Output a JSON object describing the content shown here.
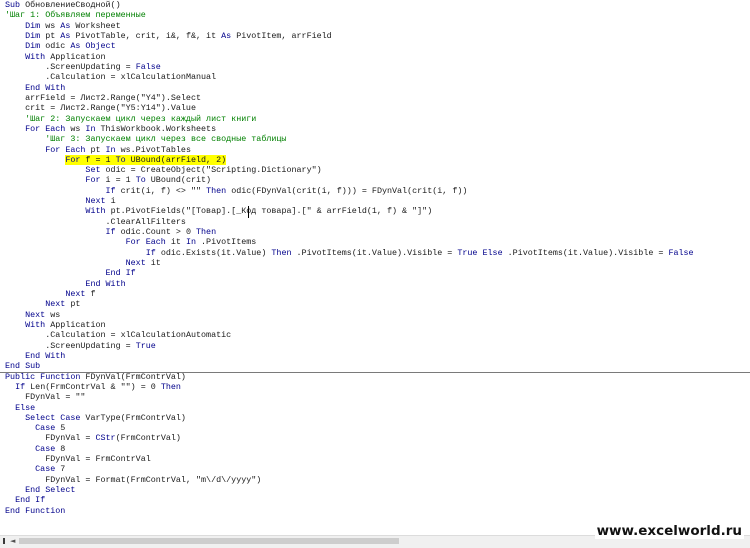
{
  "lines": [
    [
      {
        "t": "Sub ",
        "c": "k"
      },
      {
        "t": "ОбновлениеСводной()",
        "c": "t"
      }
    ],
    [
      {
        "t": "'Шаг 1: Объявляем переменные",
        "c": "c"
      }
    ],
    [
      {
        "t": "    "
      },
      {
        "t": "Dim ",
        "c": "k"
      },
      {
        "t": "ws ",
        "c": "t"
      },
      {
        "t": "As ",
        "c": "k"
      },
      {
        "t": "Worksheet",
        "c": "t"
      }
    ],
    [
      {
        "t": "    "
      },
      {
        "t": "Dim ",
        "c": "k"
      },
      {
        "t": "pt ",
        "c": "t"
      },
      {
        "t": "As ",
        "c": "k"
      },
      {
        "t": "PivotTable, crit, i&, f&, it ",
        "c": "t"
      },
      {
        "t": "As ",
        "c": "k"
      },
      {
        "t": "PivotItem, arrField",
        "c": "t"
      }
    ],
    [
      {
        "t": "    "
      },
      {
        "t": "Dim ",
        "c": "k"
      },
      {
        "t": "odic ",
        "c": "t"
      },
      {
        "t": "As Object",
        "c": "k"
      }
    ],
    [
      {
        "t": "    "
      },
      {
        "t": "With ",
        "c": "k"
      },
      {
        "t": "Application",
        "c": "t"
      }
    ],
    [
      {
        "t": "        "
      },
      {
        "t": ".ScreenUpdating = ",
        "c": "t"
      },
      {
        "t": "False",
        "c": "k"
      }
    ],
    [
      {
        "t": "        "
      },
      {
        "t": ".Calculation = xlCalculationManual",
        "c": "t"
      }
    ],
    [
      {
        "t": "    "
      },
      {
        "t": "End With",
        "c": "k"
      }
    ],
    [
      {
        "t": "    "
      },
      {
        "t": "arrField = Лист2.Range(\"Y4\").Select",
        "c": "t"
      }
    ],
    [
      {
        "t": "    "
      },
      {
        "t": "crit = Лист2.Range(\"Y5:Y14\").Value",
        "c": "t"
      }
    ],
    [
      {
        "t": "    "
      },
      {
        "t": "'Шаг 2: Запускаем цикл через каждый лист книги",
        "c": "c"
      }
    ],
    [
      {
        "t": "    "
      },
      {
        "t": "For Each ",
        "c": "k"
      },
      {
        "t": "ws ",
        "c": "t"
      },
      {
        "t": "In ",
        "c": "k"
      },
      {
        "t": "ThisWorkbook.Worksheets",
        "c": "t"
      }
    ],
    [
      {
        "t": "        "
      },
      {
        "t": "'Шаг 3: Запускаем цикл через все сводные таблицы",
        "c": "c"
      }
    ],
    [
      {
        "t": "        "
      },
      {
        "t": "For Each ",
        "c": "k"
      },
      {
        "t": "pt ",
        "c": "t"
      },
      {
        "t": "In ",
        "c": "k"
      },
      {
        "t": "ws.PivotTables",
        "c": "t"
      }
    ],
    [
      {
        "t": "            "
      },
      {
        "t": "For ",
        "c": "k",
        "h": 1
      },
      {
        "t": "f = 1 ",
        "c": "t",
        "h": 1
      },
      {
        "t": "To ",
        "c": "k",
        "h": 1
      },
      {
        "t": "UBound(arrField, 2)",
        "c": "t",
        "h": 1
      }
    ],
    [
      {
        "t": "                "
      },
      {
        "t": "Set ",
        "c": "k"
      },
      {
        "t": "odic = CreateObject(\"Scripting.Dictionary\")",
        "c": "t"
      }
    ],
    [
      {
        "t": "                "
      },
      {
        "t": "For ",
        "c": "k"
      },
      {
        "t": "i = 1 ",
        "c": "t"
      },
      {
        "t": "To ",
        "c": "k"
      },
      {
        "t": "UBound(crit)",
        "c": "t"
      }
    ],
    [
      {
        "t": "                    "
      },
      {
        "t": "If ",
        "c": "k"
      },
      {
        "t": "crit(i, f) <> \"\" ",
        "c": "t"
      },
      {
        "t": "Then ",
        "c": "k"
      },
      {
        "t": "odic(FDynVal(crit(i, f))) = FDynVal(crit(i, f))",
        "c": "t"
      }
    ],
    [
      {
        "t": "                "
      },
      {
        "t": "Next ",
        "c": "k"
      },
      {
        "t": "i",
        "c": "t"
      }
    ],
    [
      {
        "t": "                "
      },
      {
        "t": "With ",
        "c": "k"
      },
      {
        "t": "pt.PivotFields(\"[Товар].[_Код товара].[\" & arrField(1, f) & \"]\")",
        "c": "t"
      }
    ],
    [
      {
        "t": "                    "
      },
      {
        "t": ".ClearAllFilters",
        "c": "t"
      }
    ],
    [
      {
        "t": "                    "
      },
      {
        "t": "If ",
        "c": "k"
      },
      {
        "t": "odic.Count > 0 ",
        "c": "t"
      },
      {
        "t": "Then",
        "c": "k"
      }
    ],
    [
      {
        "t": "                        "
      },
      {
        "t": "For Each ",
        "c": "k"
      },
      {
        "t": "it ",
        "c": "t"
      },
      {
        "t": "In ",
        "c": "k"
      },
      {
        "t": ".PivotItems",
        "c": "t"
      }
    ],
    [
      {
        "t": "                            "
      },
      {
        "t": "If ",
        "c": "k"
      },
      {
        "t": "odic.Exists(it.Value) ",
        "c": "t"
      },
      {
        "t": "Then ",
        "c": "k"
      },
      {
        "t": ".PivotItems(it.Value).Visible = ",
        "c": "t"
      },
      {
        "t": "True Else ",
        "c": "k"
      },
      {
        "t": ".PivotItems(it.Value).Visible = ",
        "c": "t"
      },
      {
        "t": "False",
        "c": "k"
      }
    ],
    [
      {
        "t": "                        "
      },
      {
        "t": "Next ",
        "c": "k"
      },
      {
        "t": "it",
        "c": "t"
      }
    ],
    [
      {
        "t": "                    "
      },
      {
        "t": "End If",
        "c": "k"
      }
    ],
    [
      {
        "t": "                "
      },
      {
        "t": "End With",
        "c": "k"
      }
    ],
    [
      {
        "t": "            "
      },
      {
        "t": "Next ",
        "c": "k"
      },
      {
        "t": "f",
        "c": "t"
      }
    ],
    [
      {
        "t": "        "
      },
      {
        "t": "Next ",
        "c": "k"
      },
      {
        "t": "pt",
        "c": "t"
      }
    ],
    [
      {
        "t": "    "
      },
      {
        "t": "Next ",
        "c": "k"
      },
      {
        "t": "ws",
        "c": "t"
      }
    ],
    [
      {
        "t": "    "
      },
      {
        "t": "With ",
        "c": "k"
      },
      {
        "t": "Application",
        "c": "t"
      }
    ],
    [
      {
        "t": "        "
      },
      {
        "t": ".Calculation = xlCalculationAutomatic",
        "c": "t"
      }
    ],
    [
      {
        "t": "        "
      },
      {
        "t": ".ScreenUpdating = ",
        "c": "t"
      },
      {
        "t": "True",
        "c": "k"
      }
    ],
    [
      {
        "t": "    "
      },
      {
        "t": "End With",
        "c": "k"
      }
    ],
    [
      {
        "t": "End Sub",
        "c": "k"
      }
    ],
    [
      {
        "t": "Public Function ",
        "c": "k"
      },
      {
        "t": "FDynVal(FrmContrVal)",
        "c": "t"
      }
    ],
    [
      {
        "t": "  "
      },
      {
        "t": "If ",
        "c": "k"
      },
      {
        "t": "Len(FrmContrVal & \"\") = 0 ",
        "c": "t"
      },
      {
        "t": "Then",
        "c": "k"
      }
    ],
    [
      {
        "t": "    "
      },
      {
        "t": "FDynVal = \"\"",
        "c": "t"
      }
    ],
    [
      {
        "t": "  "
      },
      {
        "t": "Else",
        "c": "k"
      }
    ],
    [
      {
        "t": "    "
      },
      {
        "t": "Select Case ",
        "c": "k"
      },
      {
        "t": "VarType(FrmContrVal)",
        "c": "t"
      }
    ],
    [
      {
        "t": "      "
      },
      {
        "t": "Case ",
        "c": "k"
      },
      {
        "t": "5",
        "c": "t"
      }
    ],
    [
      {
        "t": "        "
      },
      {
        "t": "FDynVal = ",
        "c": "t"
      },
      {
        "t": "CStr",
        "c": "k"
      },
      {
        "t": "(FrmContrVal)",
        "c": "t"
      }
    ],
    [
      {
        "t": "      "
      },
      {
        "t": "Case ",
        "c": "k"
      },
      {
        "t": "8",
        "c": "t"
      }
    ],
    [
      {
        "t": "        "
      },
      {
        "t": "FDynVal = FrmContrVal",
        "c": "t"
      }
    ],
    [
      {
        "t": "      "
      },
      {
        "t": "Case ",
        "c": "k"
      },
      {
        "t": "7",
        "c": "t"
      }
    ],
    [
      {
        "t": "        "
      },
      {
        "t": "FDynVal = Format(FrmContrVal, \"m\\/d\\/yyyy\")",
        "c": "t"
      }
    ],
    [
      {
        "t": "    "
      },
      {
        "t": "End Select",
        "c": "k"
      }
    ],
    [
      {
        "t": "  "
      },
      {
        "t": "End If",
        "c": "k"
      }
    ],
    [
      {
        "t": "End Function",
        "c": "k"
      }
    ]
  ],
  "colors": {
    "keyword": "#00008b",
    "text": "#1a1a1a",
    "comment": "#008000",
    "highlight": "#ffff00"
  },
  "watermark": "www.excelworld.ru",
  "scroll_left_arrow": "◄"
}
